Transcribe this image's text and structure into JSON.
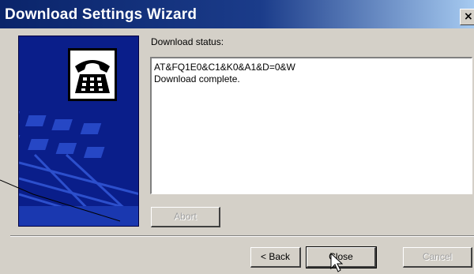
{
  "window": {
    "title": "Download Settings Wizard",
    "close_glyph": "×"
  },
  "side_panel": {
    "image": "telephone-illustration",
    "icon": "telephone-icon"
  },
  "status": {
    "label": "Download status:",
    "lines": [
      "AT&FQ1E0&C1&K0&A1&D=0&W",
      "Download complete."
    ]
  },
  "buttons": {
    "abort": "Abort",
    "back": "< Back",
    "close": "Close",
    "cancel": "Cancel"
  },
  "colors": {
    "titlebar": "#0a246a",
    "dialog_face": "#d4d0c8",
    "side_panel": "#0a1e8a"
  }
}
